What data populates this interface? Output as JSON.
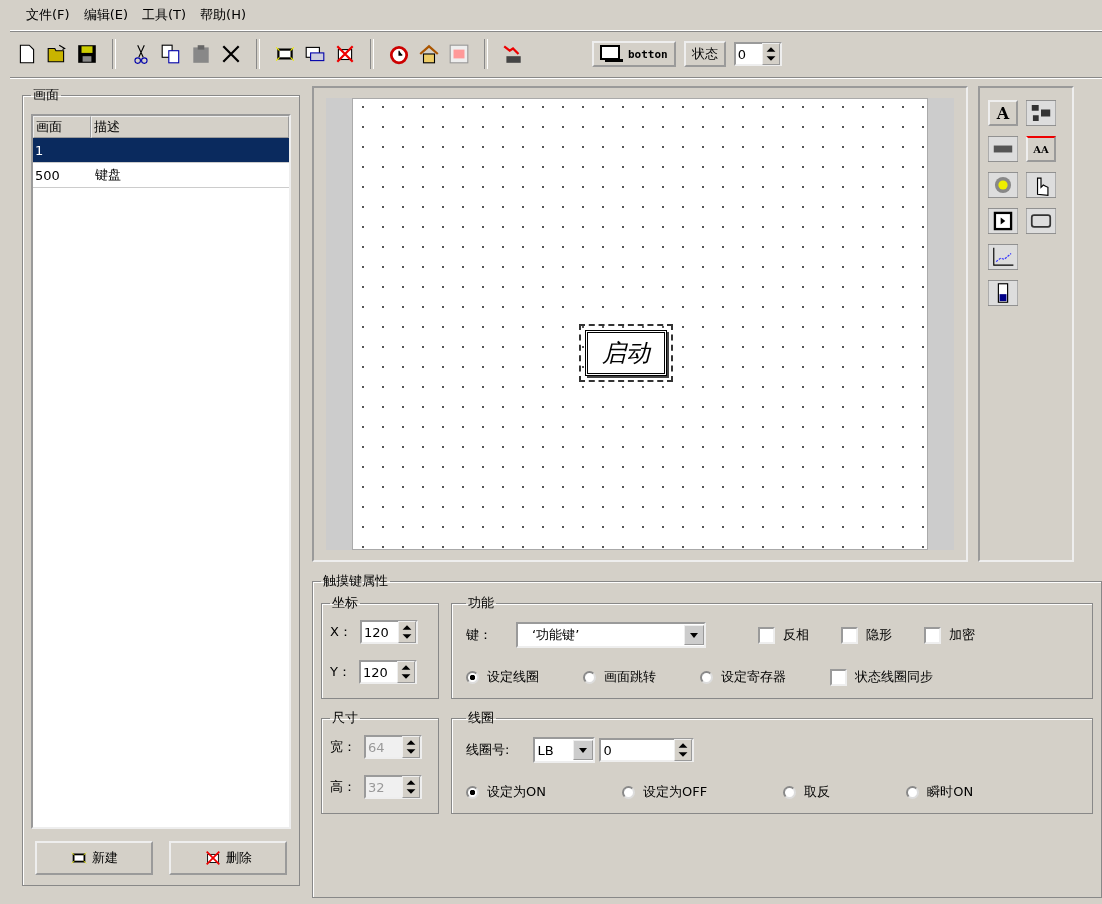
{
  "menu": [
    "文件(F)",
    "编辑(E)",
    "工具(T)",
    "帮助(H)"
  ],
  "toolbar": {
    "layer_button": "botton",
    "state_button": "状态",
    "state_value": "0"
  },
  "screens_panel": {
    "title": "画面",
    "columns": [
      "画面",
      "描述"
    ],
    "rows": [
      {
        "number": "1",
        "selected": true
      },
      {
        "number": "500",
        "description": "键盘",
        "selected": false
      }
    ],
    "buttons": [
      {
        "kind": "new",
        "label": "新建"
      },
      {
        "kind": "delete",
        "label": "删除"
      }
    ]
  },
  "canvas": {
    "button": {
      "label": "启动",
      "selected": true
    }
  },
  "toolbox": [
    {
      "kind": "text",
      "label": "A"
    },
    {
      "kind": "bitmap"
    },
    {
      "kind": "marquee"
    },
    {
      "kind": "font",
      "label": "AA"
    },
    {
      "kind": "lamp"
    },
    {
      "kind": "touch"
    },
    {
      "kind": "play"
    },
    {
      "kind": "frame"
    },
    {
      "kind": "trend"
    },
    {
      "kind": "meter"
    }
  ],
  "properties": {
    "title": "触摸键属性",
    "coords": {
      "title": "坐标",
      "fields": [
        {
          "label": "X：",
          "value": "120",
          "disabled": false
        },
        {
          "label": "Y：",
          "value": "120",
          "disabled": false
        }
      ]
    },
    "size": {
      "title": "尺寸",
      "fields": [
        {
          "label": "宽：",
          "value": "64",
          "disabled": true
        },
        {
          "label": "高：",
          "value": "32",
          "disabled": true
        }
      ]
    },
    "function": {
      "title": "功能",
      "key_label": "键：",
      "key_value": "‘功能键’",
      "checks": [
        {
          "label": "反相",
          "checked": false
        },
        {
          "label": "隐形",
          "checked": false
        },
        {
          "label": "加密",
          "checked": false
        }
      ],
      "modes": [
        {
          "label": "设定线圈",
          "selected": true
        },
        {
          "label": "画面跳转",
          "selected": false
        },
        {
          "label": "设定寄存器",
          "selected": false
        }
      ],
      "sync": {
        "label": "状态线圈同步",
        "checked": false
      }
    },
    "coil": {
      "title": "线圈",
      "number_label": "线圈号:",
      "type": "LB",
      "number": "0",
      "actions": [
        {
          "label": "设定为ON",
          "selected": true
        },
        {
          "label": "设定为OFF",
          "selected": false
        },
        {
          "label": "取反",
          "selected": false
        },
        {
          "label": "瞬时ON",
          "selected": false
        }
      ]
    }
  }
}
